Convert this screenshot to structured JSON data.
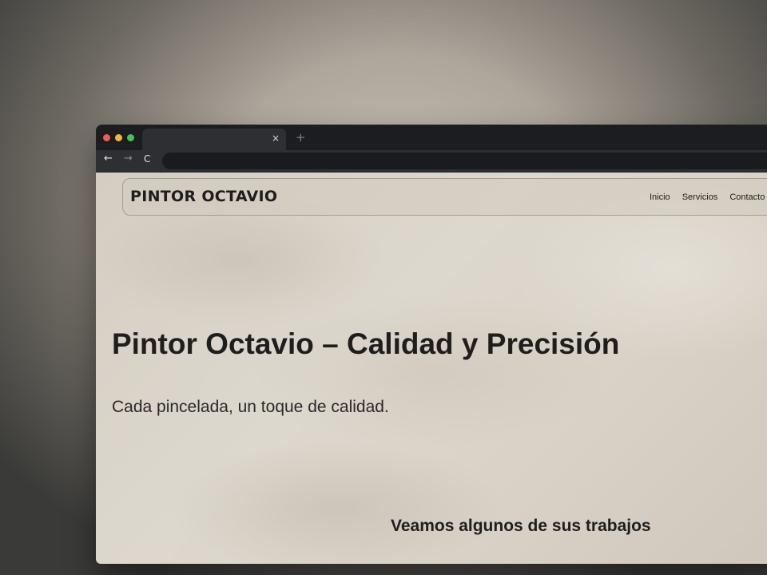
{
  "browser": {
    "tab_close": "×",
    "new_tab": "+",
    "back_icon": "←",
    "forward_icon": "→",
    "reload_icon": "C"
  },
  "site": {
    "logo": "PINTOR OCTAVIO",
    "nav": [
      "Inicio",
      "Servicios",
      "Contacto"
    ]
  },
  "hero": {
    "title": "Pintor Octavio – Calidad y Precisión",
    "subtitle": "Cada pincelada, un toque de calidad."
  },
  "works": {
    "heading": "Veamos algunos de sus trabajos"
  }
}
